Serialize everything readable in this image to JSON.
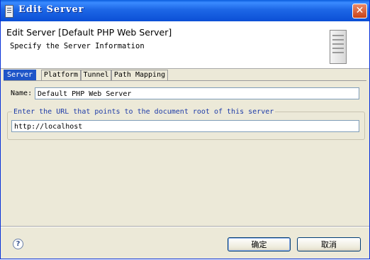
{
  "window": {
    "title": "Edit Server",
    "close_glyph": "✕"
  },
  "header": {
    "title": "Edit Server [Default PHP Web Server]",
    "subtitle": "Specify the Server Information",
    "icon": "server-icon"
  },
  "tabs": [
    {
      "label": "Server",
      "active": true
    },
    {
      "label": "Platform",
      "active": false
    },
    {
      "label": "Tunnel",
      "active": false
    },
    {
      "label": "Path Mapping",
      "active": false
    }
  ],
  "form": {
    "name_label": "Name:",
    "name_value": "Default PHP Web Server",
    "url_group_label": "Enter the URL that points to the document root of this server",
    "url_value": "http://localhost"
  },
  "footer": {
    "help_glyph": "?",
    "ok_label": "确定",
    "cancel_label": "取消"
  },
  "colors": {
    "title_bar": "#0b4fd6",
    "active_tab": "#1e55c8",
    "group_label": "#1e3ca8",
    "close_button": "#c84216"
  }
}
